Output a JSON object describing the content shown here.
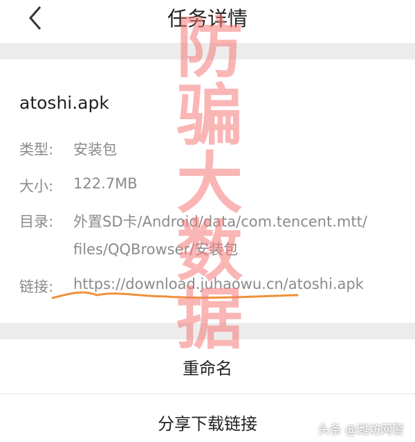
{
  "header": {
    "title": "任务详情"
  },
  "file": {
    "name": "atoshi.apk",
    "type_label": "类型:",
    "type_value": "安装包",
    "size_label": "大小:",
    "size_value": "122.7MB",
    "dir_label": "目录:",
    "dir_value_line1": "外置SD卡/Android/data/com.tencent.mtt/",
    "dir_value_line2": "files/QQBrowser/安装包",
    "link_label": "链接:",
    "link_value": "https://download.juhaowu.cn/atoshi.apk"
  },
  "actions": {
    "rename": "重命名",
    "share_link": "分享下载链接"
  },
  "watermark": [
    "防",
    "骗",
    "大",
    "数",
    "据"
  ],
  "credit": "头条 @潍坊网警",
  "colors": {
    "watermark": "#f67878",
    "underline": "#f0903a"
  }
}
